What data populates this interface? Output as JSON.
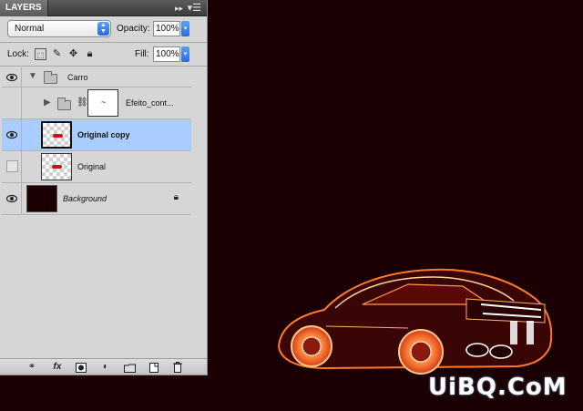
{
  "panel": {
    "title": "LAYERS",
    "collapse_glyph": "▸▸",
    "menu_glyph": "▾☰",
    "blend_mode": "Normal",
    "opacity_label": "Opacity:",
    "opacity_value": "100%",
    "lock_label": "Lock:",
    "fill_label": "Fill:",
    "fill_value": "100%"
  },
  "layers": [
    {
      "name": "Carro",
      "type": "group",
      "visible": true,
      "expanded": true
    },
    {
      "name": "Efeito_cont...",
      "type": "group",
      "visible": false,
      "expanded": false,
      "masked": true
    },
    {
      "name": "Original copy",
      "type": "layer",
      "visible": true,
      "selected": true
    },
    {
      "name": "Original",
      "type": "layer",
      "visible": false
    },
    {
      "name": "Background",
      "type": "background",
      "visible": true,
      "locked": true
    }
  ],
  "bottom_icons": [
    "link-icon",
    "fx-icon",
    "mask-icon",
    "adjustment-icon",
    "new-group-icon",
    "new-layer-icon",
    "trash-icon"
  ],
  "bottom_labels": {
    "fx": "fx"
  },
  "watermark": "UiBQ.CoM",
  "colors": {
    "canvas": "#1a0002",
    "selection": "#a9cdff",
    "panel": "#d6d6d6"
  }
}
